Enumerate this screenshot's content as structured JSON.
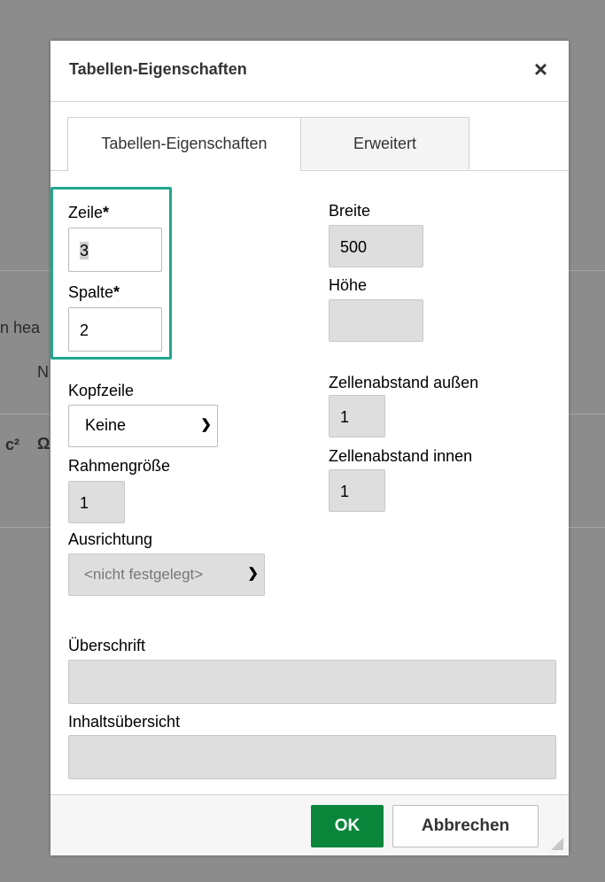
{
  "background": {
    "fragment_head": "n hea",
    "fragment_n": "N",
    "fragment_c": "c²",
    "fragment_omega": "Ω"
  },
  "dialog": {
    "title": "Tabellen-Eigenschaften",
    "close_symbol": "×",
    "tabs": [
      {
        "label": "Tabellen-Eigenschaften",
        "active": true
      },
      {
        "label": "Erweitert",
        "active": false
      }
    ],
    "fields": {
      "zeile": {
        "label": "Zeile",
        "required_mark": "*",
        "value": "3"
      },
      "spalte": {
        "label": "Spalte",
        "required_mark": "*",
        "value": "2"
      },
      "breite": {
        "label": "Breite",
        "value": "500"
      },
      "hoehe": {
        "label": "Höhe",
        "value": ""
      },
      "kopfzeile": {
        "label": "Kopfzeile",
        "selected": "Keine"
      },
      "rahmengroesse": {
        "label": "Rahmengröße",
        "value": "1"
      },
      "zellenabstand_aussen": {
        "label": "Zellenabstand außen",
        "value": "1"
      },
      "zellenabstand_innen": {
        "label": "Zellenabstand innen",
        "value": "1"
      },
      "ausrichtung": {
        "label": "Ausrichtung",
        "selected": "<nicht festgelegt>"
      },
      "ueberschrift": {
        "label": "Überschrift",
        "value": ""
      },
      "inhaltsuebersicht": {
        "label": "Inhaltsübersicht",
        "value": ""
      }
    },
    "buttons": {
      "ok": "OK",
      "cancel": "Abbrechen"
    }
  },
  "colors": {
    "ok_button": "#09863a",
    "highlight_border": "#22a68f"
  }
}
